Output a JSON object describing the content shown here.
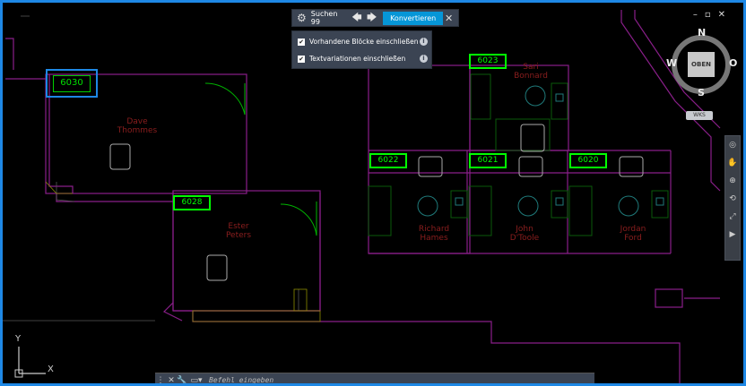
{
  "toolbar": {
    "search_label": "Suchen 99",
    "convert_label": "Konvertieren",
    "prev_icon": "arrow-left-icon",
    "next_icon": "arrow-right-icon",
    "settings_icon": "gear-icon",
    "close_icon": "close-icon"
  },
  "options": {
    "include_blocks": {
      "label": "Vorhandene Blöcke einschließen",
      "checked": true
    },
    "include_text_variations": {
      "label": "Textvariationen einschließen",
      "checked": true
    }
  },
  "viewcube": {
    "face": "OBEN",
    "north": "N",
    "south": "S",
    "east": "O",
    "west": "W",
    "ucs_menu": "WKS"
  },
  "command_line": {
    "placeholder": "Befehl eingeben"
  },
  "ucs": {
    "x": "X",
    "y": "Y"
  },
  "rooms": {
    "selected": "6030",
    "tags": [
      "6023",
      "6028",
      "6022",
      "6021",
      "6020"
    ],
    "people": [
      {
        "name": "Dave Thommes"
      },
      {
        "name": "Ester Peters"
      },
      {
        "name": "Sari Bonnard"
      },
      {
        "name": "Richard Hames"
      },
      {
        "name": "John D'Toole"
      },
      {
        "name": "Jordan Ford"
      }
    ]
  },
  "colors": {
    "accent": "#0696d7",
    "highlight": "#00ff00",
    "selection": "#1e88e5",
    "wall": "#a020a0"
  }
}
